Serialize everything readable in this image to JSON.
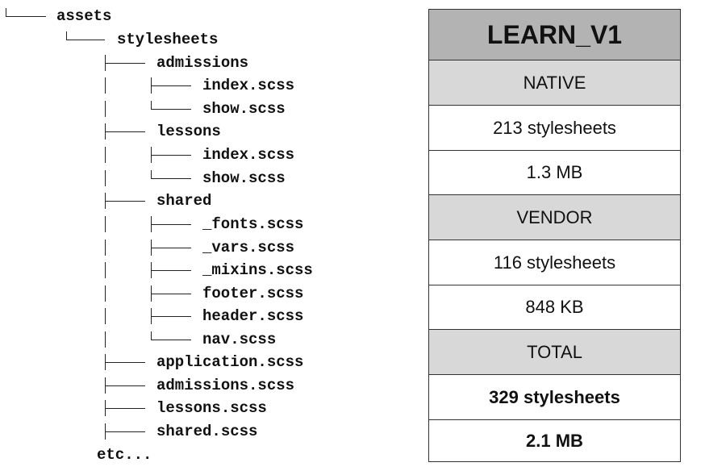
{
  "tree": {
    "root": "assets",
    "stylesheets": "stylesheets",
    "admissions_dir": "admissions",
    "admissions_index": "index.scss",
    "admissions_show": "show.scss",
    "lessons_dir": "lessons",
    "lessons_index": "index.scss",
    "lessons_show": "show.scss",
    "shared_dir": "shared",
    "shared_fonts": "_fonts.scss",
    "shared_vars": "_vars.scss",
    "shared_mixins": "_mixins.scss",
    "shared_footer": "footer.scss",
    "shared_header": "header.scss",
    "shared_nav": "nav.scss",
    "application": "application.scss",
    "admissions_file": "admissions.scss",
    "lessons_file": "lessons.scss",
    "shared_file": "shared.scss",
    "etc": "etc..."
  },
  "table": {
    "title": "LEARN_V1",
    "native_header": "NATIVE",
    "native_count": "213 stylesheets",
    "native_size": "1.3 MB",
    "vendor_header": "VENDOR",
    "vendor_count": "116 stylesheets",
    "vendor_size": "848 KB",
    "total_header": "TOTAL",
    "total_count": "329 stylesheets",
    "total_size": "2.1 MB"
  },
  "colors": {
    "title_background": "#b3b3b3",
    "section_background": "#d8d8d8",
    "text": "#111111"
  }
}
